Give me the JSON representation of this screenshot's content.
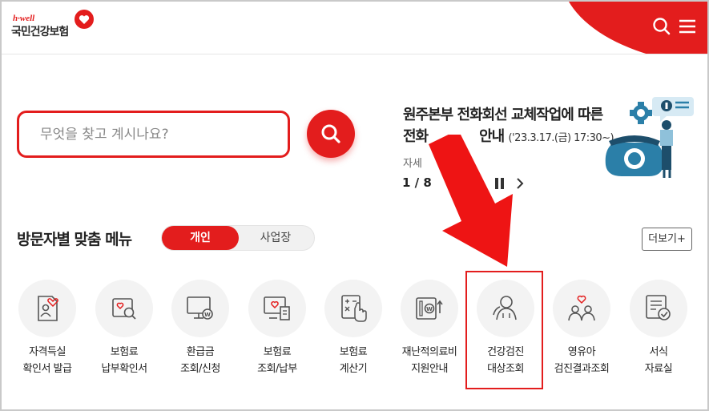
{
  "header": {
    "logo_brand": "h·well",
    "logo_name": "국민건강보험",
    "search_icon": "search-icon",
    "menu_icon": "hamburger-menu-icon"
  },
  "search": {
    "placeholder": "무엇을 찾고 계시나요?",
    "button_icon": "search-icon"
  },
  "notice": {
    "title_line1": "원주본부 전화회선 교체작업에 따른",
    "title_line2": "전화",
    "title_line2_rest": "안내",
    "date": "('23.3.17.(금) 17:30~)",
    "more_text": "자세",
    "pager": "1 / 8"
  },
  "menu": {
    "title": "방문자별 맞춤 메뉴",
    "toggle_personal": "개인",
    "toggle_business": "사업장",
    "more_button": "더보기+",
    "items": [
      {
        "line1": "자격득실",
        "line2": "확인서 발급",
        "icon": "qualification-doc-icon"
      },
      {
        "line1": "보험료",
        "line2": "납부확인서",
        "icon": "payment-confirmation-icon"
      },
      {
        "line1": "환급금",
        "line2": "조회/신청",
        "icon": "refund-monitor-icon"
      },
      {
        "line1": "보험료",
        "line2": "조회/납부",
        "icon": "premium-payment-icon"
      },
      {
        "line1": "보험료",
        "line2": "계산기",
        "icon": "calculator-icon"
      },
      {
        "line1": "재난적의료비",
        "line2": "지원안내",
        "icon": "medical-support-icon"
      },
      {
        "line1": "건강검진",
        "line2": "대상조회",
        "icon": "health-checkup-user-icon"
      },
      {
        "line1": "영유아",
        "line2": "검진결과조회",
        "icon": "infant-checkup-icon"
      },
      {
        "line1": "서식",
        "line2": "자료실",
        "icon": "forms-library-icon"
      }
    ]
  },
  "colors": {
    "accent": "#e31d1d",
    "circle_bg": "#f3f3f3"
  }
}
